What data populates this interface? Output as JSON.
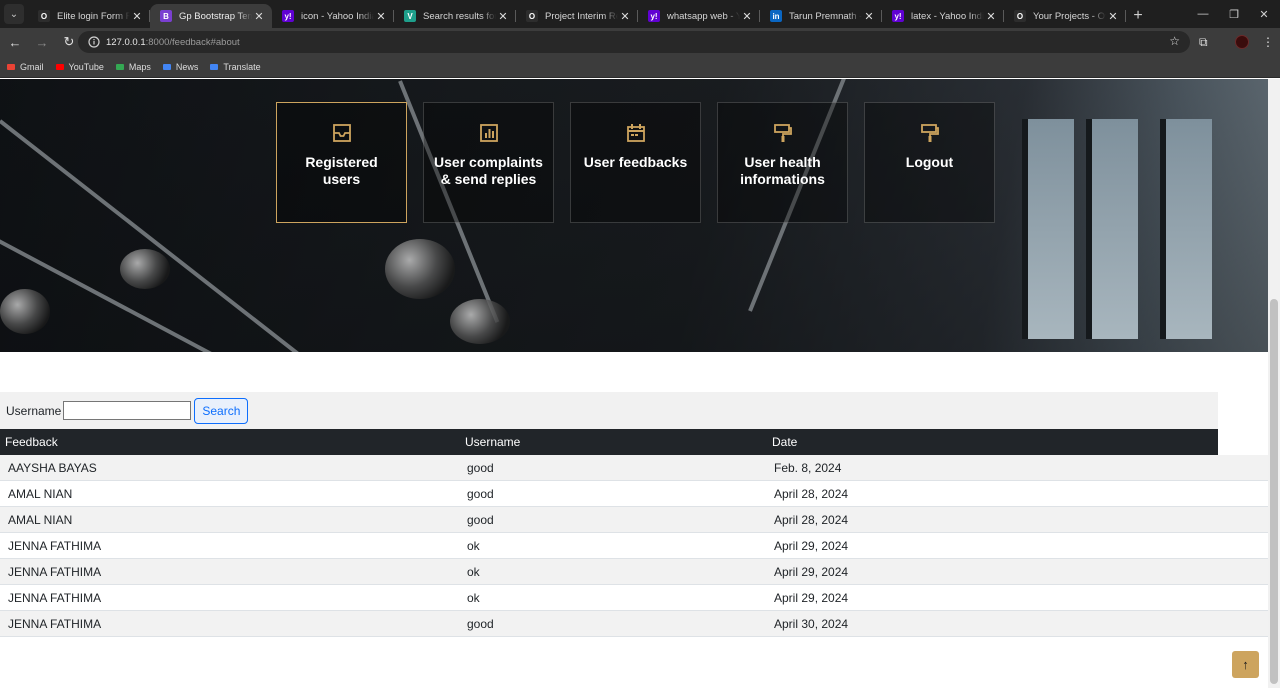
{
  "browser": {
    "tabs": [
      {
        "title": "Elite login Form Resp",
        "favicon": "O",
        "favicon_color": "#2d2d2d",
        "active": false
      },
      {
        "title": "Gp Bootstrap Templat",
        "favicon": "B",
        "favicon_color": "#7a3fd1",
        "active": true
      },
      {
        "title": "icon - Yahoo India Se",
        "favicon": "y!",
        "favicon_color": "#6001d2",
        "active": false
      },
      {
        "title": "Search results for Ca",
        "favicon": "V",
        "favicon_color": "#1e9f8b",
        "active": false
      },
      {
        "title": "Project Interim Repor",
        "favicon": "O",
        "favicon_color": "#2d2d2d",
        "active": false
      },
      {
        "title": "whatsapp web - Yaho",
        "favicon": "y!",
        "favicon_color": "#6001d2",
        "active": false
      },
      {
        "title": "Tarun Premnath - Ch",
        "favicon": "in",
        "favicon_color": "#0a66c2",
        "active": false
      },
      {
        "title": "latex - Yahoo India Se",
        "favicon": "y!",
        "favicon_color": "#6001d2",
        "active": false
      },
      {
        "title": "Your Projects - Overle",
        "favicon": "O",
        "favicon_color": "#2d2d2d",
        "active": false
      }
    ],
    "url_host": "127.0.0.1",
    "url_path": ":8000/feedback#about",
    "bookmarks": [
      {
        "label": "Gmail",
        "icon": "gmail-icon",
        "color": "#ea4335"
      },
      {
        "label": "YouTube",
        "icon": "youtube-icon",
        "color": "#ff0000"
      },
      {
        "label": "Maps",
        "icon": "maps-icon",
        "color": "#34a853"
      },
      {
        "label": "News",
        "icon": "news-icon",
        "color": "#4285f4"
      },
      {
        "label": "Translate",
        "icon": "translate-icon",
        "color": "#4285f4"
      }
    ]
  },
  "nav_cards": [
    {
      "label": "Registered users",
      "icon": "inbox-icon",
      "active": true
    },
    {
      "label": "User complaints & send replies",
      "icon": "chart-icon",
      "active": false
    },
    {
      "label": "User feedbacks",
      "icon": "calendar-icon",
      "active": false
    },
    {
      "label": "User health informations",
      "icon": "paint-roller-icon",
      "active": false
    },
    {
      "label": "Logout",
      "icon": "paint-roller-icon",
      "active": false
    }
  ],
  "search": {
    "label": "Username",
    "value": "",
    "button": "Search"
  },
  "table": {
    "headers": [
      "Feedback",
      "Username",
      "Date"
    ],
    "rows": [
      [
        "AAYSHA BAYAS",
        "good",
        "Feb. 8, 2024"
      ],
      [
        "AMAL NIAN",
        "good",
        "April 28, 2024"
      ],
      [
        "AMAL NIAN",
        "good",
        "April 28, 2024"
      ],
      [
        "JENNA FATHIMA",
        "ok",
        "April 29, 2024"
      ],
      [
        "JENNA FATHIMA",
        "ok",
        "April 29, 2024"
      ],
      [
        "JENNA FATHIMA",
        "ok",
        "April 29, 2024"
      ],
      [
        "JENNA FATHIMA",
        "good",
        "April 30, 2024"
      ]
    ]
  },
  "colors": {
    "accent": "#cda45e",
    "table_header": "#212529",
    "button": "#0d6efd"
  },
  "back_to_top_icon": "arrow-up-icon"
}
